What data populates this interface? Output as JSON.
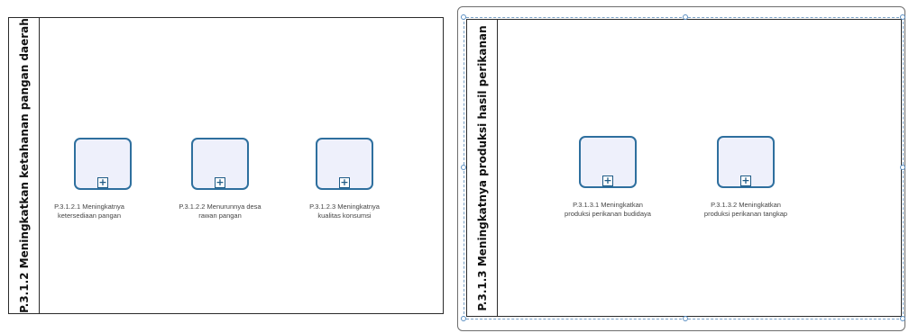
{
  "pools": [
    {
      "title": "P.3.1.2 Meningkatkan ketahanan pangan daerah",
      "tasks": [
        {
          "label": "P.3.1.2.1 Meningkatnya ketersediaan pangan",
          "marker": "+"
        },
        {
          "label": "P.3.1.2.2 Menurunnya desa rawan pangan",
          "marker": "+"
        },
        {
          "label": "P.3.1.2.3 Meningkatnya kualitas konsumsi",
          "marker": "+"
        }
      ]
    },
    {
      "title": "P.3.1.3 Meningkatnya produksi hasil perikanan",
      "tasks": [
        {
          "label": "P.3.1.3.1 Meningkatkan produksi perikanan budidaya",
          "marker": "+"
        },
        {
          "label": "P.3.1.3.2 Meningkatkan produksi perikanan tangkap",
          "marker": "+"
        }
      ]
    }
  ],
  "colors": {
    "task_border": "#2e6f9e",
    "task_fill": "#eef0fb",
    "pool_border": "#2b2b2b",
    "selection_handle": "#5b8fc2"
  }
}
